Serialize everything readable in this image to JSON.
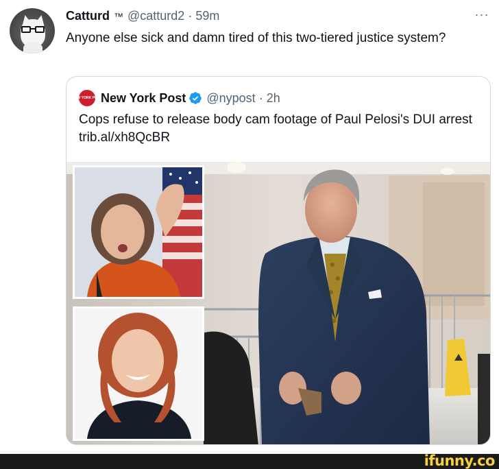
{
  "tweet": {
    "author_name": "Catturd",
    "author_suffix": "™",
    "handle": "@catturd2",
    "separator": "·",
    "time": "59m",
    "more_label": "···",
    "text": "Anyone else sick and damn tired of this two-tiered justice system?"
  },
  "quote": {
    "logo_text": "NEW YORK POST",
    "name": "New York Post",
    "handle": "@nypost",
    "separator": "·",
    "time": "2h",
    "text": "Cops refuse to release body cam footage of Paul Pelosi's DUI arrest trib.al/xh8QcBR"
  },
  "icons": {
    "verified": "verified-badge-icon",
    "more": "more-options-icon"
  },
  "colors": {
    "verified_blue": "#1d9bf0",
    "nypost_red": "#cc1f2d",
    "secondary_text": "#536471",
    "watermark_yellow": "#f7d13d"
  },
  "watermark": {
    "text": "ifunny.co"
  }
}
